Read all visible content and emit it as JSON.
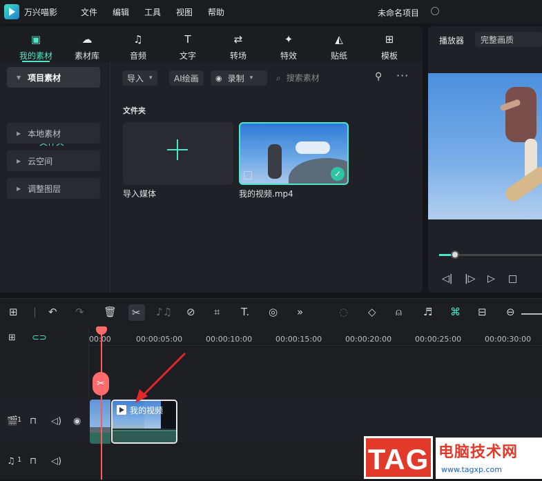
{
  "app": {
    "name": "万兴喵影",
    "project_name": "未命名项目"
  },
  "menu": [
    "文件",
    "编辑",
    "工具",
    "视图",
    "帮助"
  ],
  "tabs": [
    {
      "label": "我的素材",
      "icon": "image-folder-icon"
    },
    {
      "label": "素材库",
      "icon": "cloud-folder-icon"
    },
    {
      "label": "音频",
      "icon": "music-note-icon"
    },
    {
      "label": "文字",
      "icon": "text-t-icon"
    },
    {
      "label": "转场",
      "icon": "transition-icon"
    },
    {
      "label": "特效",
      "icon": "sparkle-icon"
    },
    {
      "label": "贴纸",
      "icon": "sticker-icon"
    },
    {
      "label": "模板",
      "icon": "template-icon"
    }
  ],
  "sidebar": {
    "project_assets": "项目素材",
    "folder": "文件夹",
    "items": [
      "本地素材",
      "云空间",
      "调整图层"
    ]
  },
  "toolbar": {
    "import": "导入",
    "ai_paint": "AI绘画",
    "record": "录制",
    "search_placeholder": "搜索素材"
  },
  "media": {
    "folder_title": "文件夹",
    "import_label": "导入媒体",
    "video_label": "我的视频.mp4"
  },
  "player": {
    "title": "播放器",
    "quality": "完整画质",
    "progress": 0.15
  },
  "timeline": {
    "ticks": [
      "00:00",
      "00:00:05:00",
      "00:00:10:00",
      "00:00:15:00",
      "00:00:20:00",
      "00:00:25:00",
      "00:00:30:00"
    ],
    "clip_label": "我的视频",
    "video_track": "1",
    "audio_track": "1"
  },
  "watermark": {
    "tag": "TAG",
    "site_name": "电脑技术网",
    "url": "www.tagxp.com"
  },
  "colors": {
    "accent": "#4ee6c8",
    "playhead": "#ff5a5a"
  }
}
